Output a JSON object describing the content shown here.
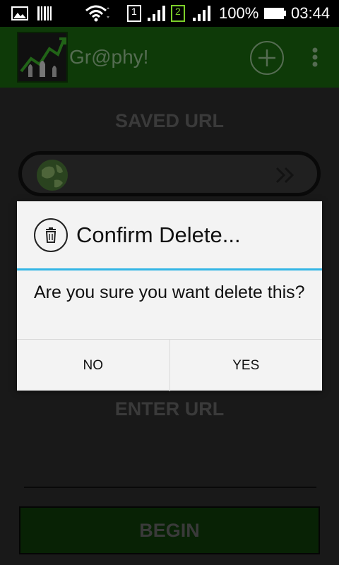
{
  "status_bar": {
    "battery_percent": "100%",
    "time": "03:44",
    "sim1_label": "1",
    "sim2_label": "2",
    "icons": [
      "gallery-icon",
      "barcode-icon",
      "wifi-icon",
      "sim1-icon",
      "signal-icon",
      "sim2-icon",
      "signal-icon",
      "battery-icon"
    ]
  },
  "app_bar": {
    "title": "Gr@phy!",
    "icons": [
      "app-logo",
      "add-circle-icon",
      "overflow-menu-icon"
    ],
    "colors": {
      "background": "#1a6a10",
      "title": "#9cc596"
    }
  },
  "main": {
    "saved_url_label": "SAVED URL",
    "saved_url_value": "",
    "enter_url_label": "ENTER URL",
    "enter_url_value": "",
    "begin_label": "BEGIN",
    "icons": [
      "globe-icon",
      "double-chevron-right-icon"
    ]
  },
  "dialog": {
    "title": "Confirm Delete...",
    "message": "Are you sure you want delete this?",
    "no_label": "NO",
    "yes_label": "YES",
    "icon": "trash-icon",
    "accent_color": "#33b5e5"
  }
}
